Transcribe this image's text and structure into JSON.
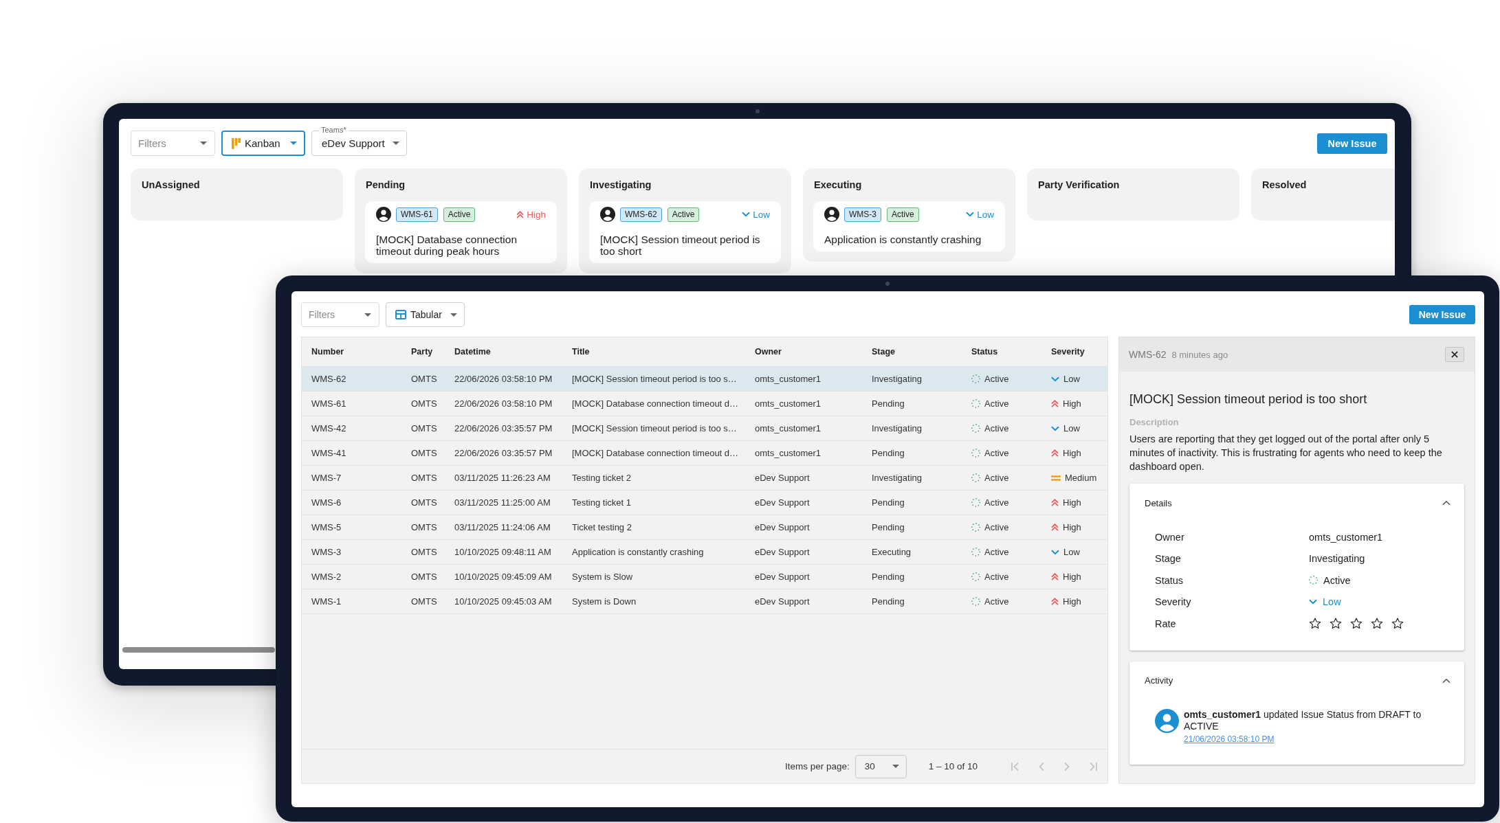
{
  "devices": [
    {
      "kind": "kanban",
      "toolbar": {
        "filters": {
          "placeholder": "Filters"
        },
        "view": {
          "label": "Kanban",
          "focused": true
        },
        "teams": {
          "label": "Teams*",
          "value": "eDev Support"
        },
        "new_issue_button": "New Issue"
      },
      "columns": [
        {
          "title": "UnAssigned"
        },
        {
          "title": "Pending",
          "cards": [
            {
              "number": "WMS-61",
              "status": "Active",
              "severity": {
                "kind": "high",
                "label": "High"
              },
              "title": "[MOCK] Database connection timeout during peak hours"
            }
          ]
        },
        {
          "title": "Investigating",
          "cards": [
            {
              "number": "WMS-62",
              "status": "Active",
              "severity": {
                "kind": "low",
                "label": "Low"
              },
              "title": "[MOCK] Session timeout period is too short"
            }
          ]
        },
        {
          "title": "Executing",
          "cards": [
            {
              "number": "WMS-3",
              "status": "Active",
              "severity": {
                "kind": "low",
                "label": "Low"
              },
              "title": "Application is constantly crashing"
            }
          ]
        },
        {
          "title": "Party Verification"
        },
        {
          "title": "Resolved"
        }
      ]
    },
    {
      "kind": "table",
      "toolbar": {
        "filters": {
          "placeholder": "Filters"
        },
        "view": {
          "label": "Tabular",
          "focused": false
        },
        "new_issue_button": "New Issue"
      },
      "table": {
        "columns": [
          "Number",
          "Party",
          "Datetime",
          "Title",
          "Owner",
          "Stage",
          "Status",
          "Severity"
        ],
        "rows": [
          {
            "selected": true,
            "number": "WMS-62",
            "party": "OMTS",
            "datetime": "22/06/2026 03:58:10 PM",
            "title": "[MOCK] Session timeout period is too s…",
            "owner": "omts_customer1",
            "stage": "Investigating",
            "status": "Active",
            "severity": {
              "kind": "low",
              "label": "Low"
            }
          },
          {
            "selected": false,
            "number": "WMS-61",
            "party": "OMTS",
            "datetime": "22/06/2026 03:58:10 PM",
            "title": "[MOCK] Database connection timeout d…",
            "owner": "omts_customer1",
            "stage": "Pending",
            "status": "Active",
            "severity": {
              "kind": "high",
              "label": "High"
            }
          },
          {
            "selected": false,
            "number": "WMS-42",
            "party": "OMTS",
            "datetime": "22/06/2026 03:35:57 PM",
            "title": "[MOCK] Session timeout period is too s…",
            "owner": "omts_customer1",
            "stage": "Investigating",
            "status": "Active",
            "severity": {
              "kind": "low",
              "label": "Low"
            }
          },
          {
            "selected": false,
            "number": "WMS-41",
            "party": "OMTS",
            "datetime": "22/06/2026 03:35:57 PM",
            "title": "[MOCK] Database connection timeout d…",
            "owner": "omts_customer1",
            "stage": "Pending",
            "status": "Active",
            "severity": {
              "kind": "high",
              "label": "High"
            }
          },
          {
            "selected": false,
            "number": "WMS-7",
            "party": "OMTS",
            "datetime": "03/11/2025 11:26:23 AM",
            "title": "Testing ticket 2",
            "owner": "eDev Support",
            "stage": "Investigating",
            "status": "Active",
            "severity": {
              "kind": "medium",
              "label": "Medium"
            }
          },
          {
            "selected": false,
            "number": "WMS-6",
            "party": "OMTS",
            "datetime": "03/11/2025 11:25:00 AM",
            "title": "Testing ticket 1",
            "owner": "eDev Support",
            "stage": "Pending",
            "status": "Active",
            "severity": {
              "kind": "high",
              "label": "High"
            }
          },
          {
            "selected": false,
            "number": "WMS-5",
            "party": "OMTS",
            "datetime": "03/11/2025 11:24:06 AM",
            "title": "Ticket testing 2",
            "owner": "eDev Support",
            "stage": "Pending",
            "status": "Active",
            "severity": {
              "kind": "high",
              "label": "High"
            }
          },
          {
            "selected": false,
            "number": "WMS-3",
            "party": "OMTS",
            "datetime": "10/10/2025 09:48:11 AM",
            "title": "Application is constantly crashing",
            "owner": "eDev Support",
            "stage": "Executing",
            "status": "Active",
            "severity": {
              "kind": "low",
              "label": "Low"
            }
          },
          {
            "selected": false,
            "number": "WMS-2",
            "party": "OMTS",
            "datetime": "10/10/2025 09:45:09 AM",
            "title": "System is Slow",
            "owner": "eDev Support",
            "stage": "Pending",
            "status": "Active",
            "severity": {
              "kind": "high",
              "label": "High"
            }
          },
          {
            "selected": false,
            "number": "WMS-1",
            "party": "OMTS",
            "datetime": "10/10/2025 09:45:03 AM",
            "title": "System is Down",
            "owner": "eDev Support",
            "stage": "Pending",
            "status": "Active",
            "severity": {
              "kind": "high",
              "label": "High"
            }
          }
        ],
        "pagination": {
          "items_per_page_label": "Items per page:",
          "page_size": "30",
          "range": "1 – 10 of 10",
          "buttons": [
            {
              "kind": "first",
              "disabled": true
            },
            {
              "kind": "previous",
              "disabled": true
            },
            {
              "kind": "next",
              "disabled": true
            },
            {
              "kind": "last",
              "disabled": true
            }
          ]
        }
      },
      "detail_panel": {
        "number": "WMS-62",
        "age": "8 minutes ago",
        "title": "[MOCK] Session timeout period is too short",
        "description_label": "Description",
        "description": "Users are reporting that they get logged out of the portal after only 5 minutes of inactivity. This is frustrating for agents who need to keep the dashboard open.",
        "details": {
          "title": "Details",
          "expanded": true,
          "rows": [
            {
              "kind": "text",
              "label": "Owner",
              "value": "omts_customer1"
            },
            {
              "kind": "text",
              "label": "Stage",
              "value": "Investigating"
            },
            {
              "kind": "status",
              "label": "Status",
              "value": "Active"
            },
            {
              "kind": "severity",
              "label": "Severity",
              "severity": {
                "kind": "low",
                "label": "Low"
              }
            },
            {
              "kind": "rating",
              "label": "Rate",
              "stars": 0
            }
          ]
        },
        "activity": {
          "title": "Activity",
          "expanded": true,
          "entries": [
            {
              "text": "**omts_customer1** updated Issue Status from DRAFT to ACTIVE",
              "time": "21/06/2026 03:58:10 PM"
            }
          ]
        }
      }
    }
  ]
}
